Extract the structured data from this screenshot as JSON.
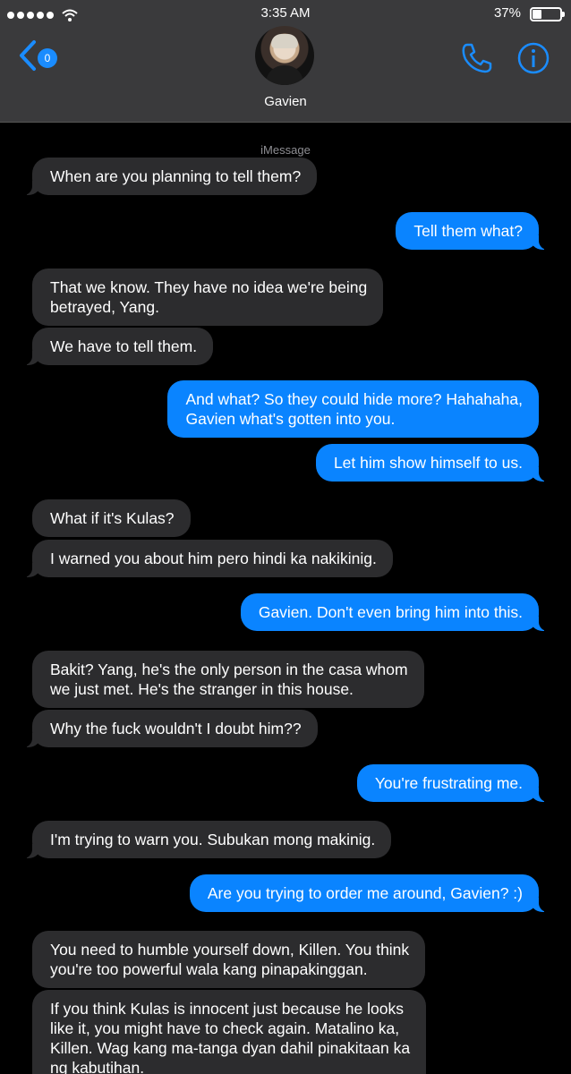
{
  "status_bar": {
    "time": "3:35 AM",
    "battery": "37%",
    "battery_level": 0.37,
    "signal_bars": 5
  },
  "header": {
    "back_badge": "0",
    "contact_name": "Gavien",
    "accent_color": "#1a8cff",
    "icons": [
      "back-chevron-icon",
      "phone-icon",
      "info-icon"
    ]
  },
  "service_label": "iMessage",
  "colors": {
    "incoming_bubble": "#2c2c2e",
    "outgoing_bubble": "#0a84ff",
    "background": "#000000",
    "header": "#3a3a3c"
  },
  "messages": [
    {
      "from": "them",
      "lines": [
        "When are you planning to tell them?"
      ]
    },
    {
      "from": "me",
      "lines": [
        "Tell them what?"
      ]
    },
    {
      "from": "them",
      "lines": [
        "That we know. They have no idea we're being",
        "betrayed, Yang."
      ]
    },
    {
      "from": "them",
      "lines": [
        "We have to tell them."
      ]
    },
    {
      "from": "me",
      "lines": [
        "And what? So they could hide more? Hahahaha,",
        "Gavien what's gotten into you."
      ]
    },
    {
      "from": "me",
      "lines": [
        "Let him show himself to us."
      ]
    },
    {
      "from": "them",
      "lines": [
        "What if it's Kulas?"
      ]
    },
    {
      "from": "them",
      "lines": [
        "I warned you about him pero hindi ka nakikinig."
      ]
    },
    {
      "from": "me",
      "lines": [
        "Gavien. Don't even bring him into this."
      ]
    },
    {
      "from": "them",
      "lines": [
        "Bakit? Yang, he's the only person in the casa whom",
        "we just met. He's the stranger in this house."
      ]
    },
    {
      "from": "them",
      "lines": [
        "Why the fuck wouldn't I doubt him??"
      ]
    },
    {
      "from": "me",
      "lines": [
        "You're frustrating me."
      ]
    },
    {
      "from": "them",
      "lines": [
        "I'm trying to warn you. Subukan mong makinig."
      ]
    },
    {
      "from": "me",
      "lines": [
        "Are you trying to order me around, Gavien? :)"
      ]
    },
    {
      "from": "them",
      "lines": [
        "You need to humble yourself down, Killen. You think",
        "you're too powerful wala kang pinapakinggan."
      ]
    },
    {
      "from": "them",
      "lines": [
        "If you think Kulas is innocent just because he looks",
        "like it, you might have to check again. Matalino ka,",
        "Killen. Wag kang ma-tanga dyan dahil pinakitaan ka",
        "ng kabutihan."
      ]
    }
  ]
}
